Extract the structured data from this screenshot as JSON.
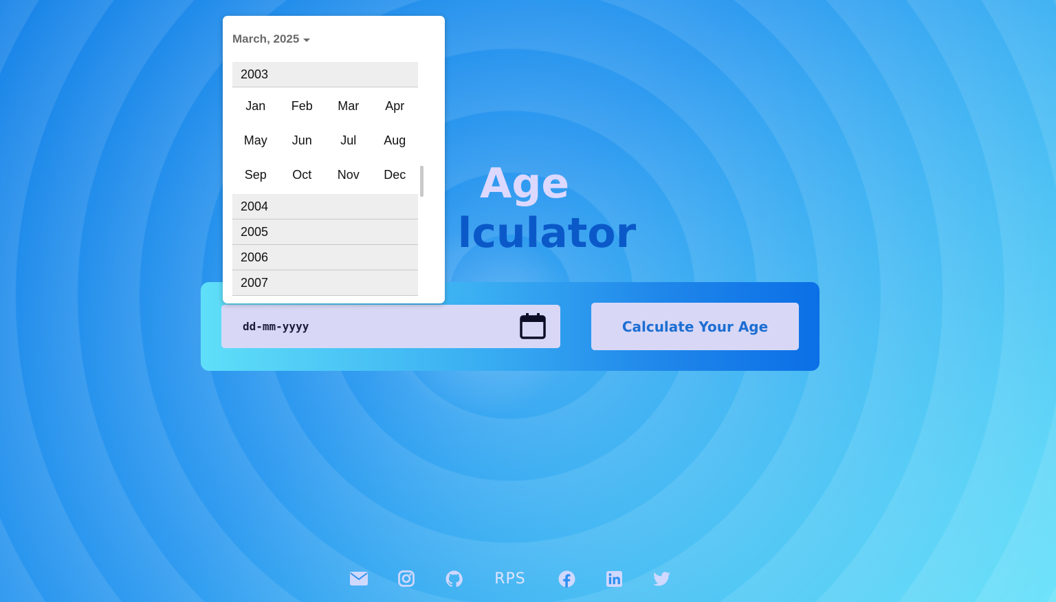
{
  "title": {
    "line1": "Age",
    "line2": "lculator"
  },
  "date_input": {
    "placeholder": "dd-mm-yyyy"
  },
  "calculate_button": {
    "label": "Calculate Your Age"
  },
  "datepicker": {
    "header": "March, 2025",
    "expanded_year": "2003",
    "months": [
      "Jan",
      "Feb",
      "Mar",
      "Apr",
      "May",
      "Jun",
      "Jul",
      "Aug",
      "Sep",
      "Oct",
      "Nov",
      "Dec"
    ],
    "years_after": [
      "2004",
      "2005",
      "2006",
      "2007"
    ]
  },
  "footer": {
    "rps_label": "RPS",
    "icons": [
      "email-icon",
      "instagram-icon",
      "github-icon",
      "rps-link",
      "facebook-icon",
      "linkedin-icon",
      "twitter-icon"
    ]
  },
  "colors": {
    "title_light": "#dcd8ff",
    "title_dark": "#0b59c9",
    "button_text": "#1d6ed3",
    "input_bg": "#d8d8f6"
  }
}
